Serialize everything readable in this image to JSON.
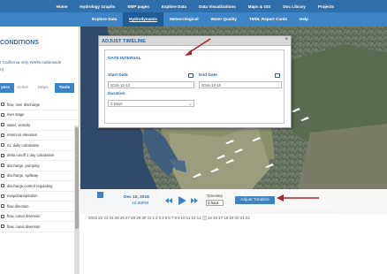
{
  "nav_top": [
    "Home",
    "Hydrology Graphs",
    "EMP pages",
    "Explore Data",
    "Data Visualizations",
    "Maps & GIS",
    "Doc Library",
    "Projects"
  ],
  "nav_sub": [
    "Explore Data",
    "Hydrodynamic",
    "Meteorological",
    "Water Quality",
    "TMDL Report Cards",
    "Help"
  ],
  "nav_sub_active": "Hydrodynamic",
  "side": {
    "title": "CONDITIONS",
    "desc1": "r California only, NWIS nationwide",
    "desc2": "n)",
    "tabs": {
      "layers": "yers",
      "active": "Active",
      "maps": "Maps",
      "tools": "Tools"
    },
    "layers": [
      "flow, river discharge",
      "river stage",
      "water, velocity",
      "reservoir elevation",
      "s1, daily calculation",
      "delta runoff 1 day calculation",
      "discharge, pumping",
      "discharge, spillway",
      "discharge,control regulating",
      "evapotranspiration",
      "flow direction",
      "flow, canal diversion",
      "flow, canal diversion"
    ]
  },
  "dialog": {
    "title": "ADJUST TIMELINE",
    "close": "×",
    "section": "DATE INTERVAL",
    "start_label": "Start Date",
    "start_value": "2016-12-12",
    "end_label": "End Date",
    "end_value": "2016-12-15",
    "duration_label": "Duration",
    "duration_value": "3 Days"
  },
  "player": {
    "date": "Dec 15, 2016",
    "time": "12:30PM",
    "timestep_label": "Timestep",
    "timestep_value": "1 hour",
    "adjust_button": "Adjust Timeline"
  },
  "timeline_days": [
    "2021",
    "22",
    "23",
    "24",
    "25",
    "26",
    "27",
    "28",
    "29",
    "30",
    "31",
    "1",
    "2",
    "3",
    "4",
    "5",
    "6",
    "7",
    "8",
    "9",
    "10",
    "11",
    "12",
    "13",
    "14",
    "15",
    "16",
    "17",
    "18",
    "19",
    "20",
    "21",
    "22"
  ],
  "timeline_selected_index": 24,
  "colors": {
    "nav_dark": "#2e6fac",
    "nav_light": "#3d84c6",
    "accent_text": "#2b6aa5",
    "arrow": "#a0282c"
  }
}
